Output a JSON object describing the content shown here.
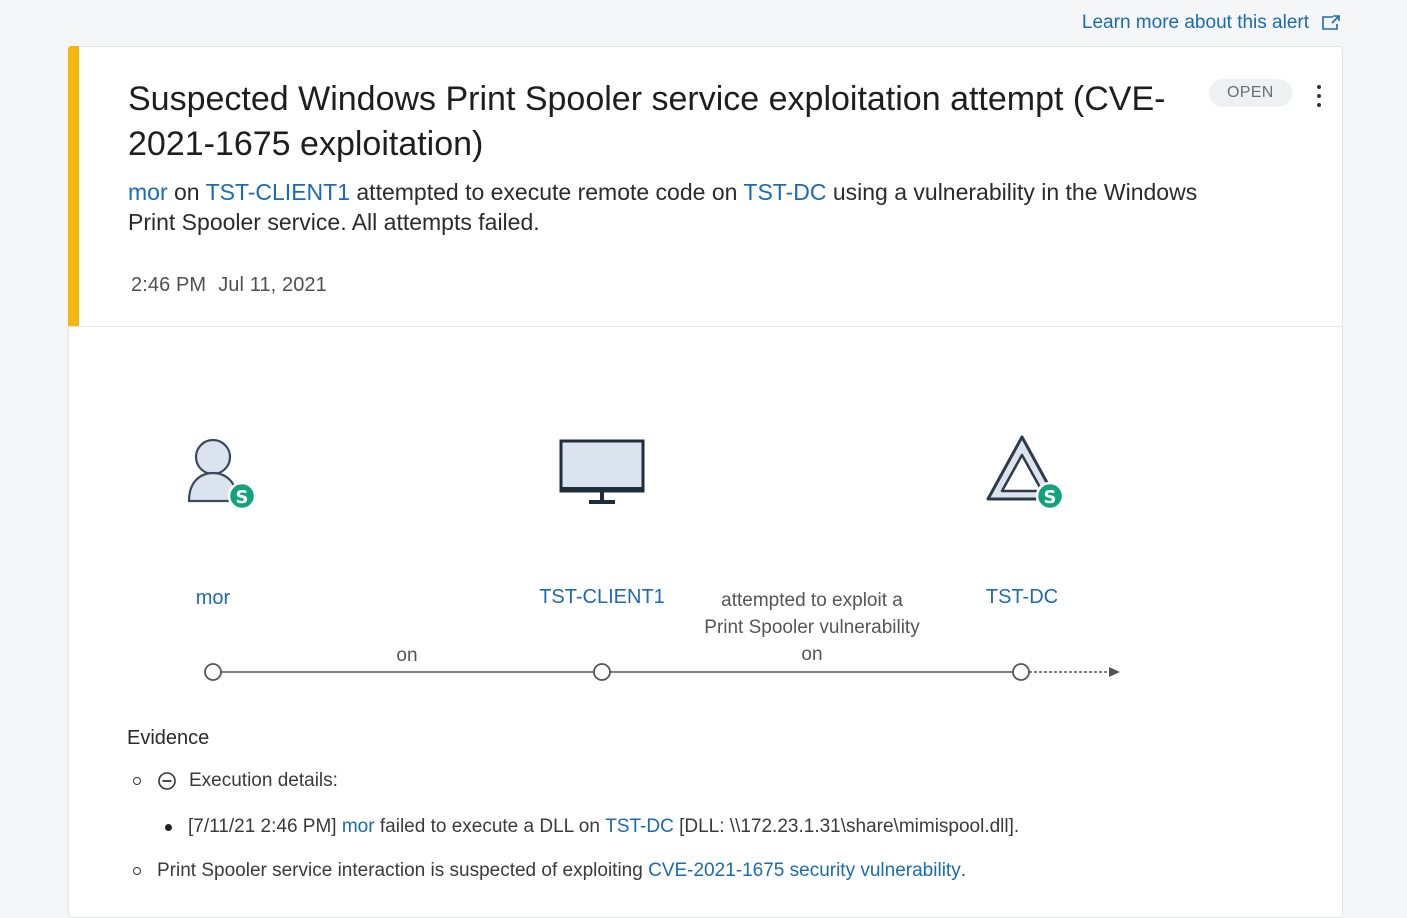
{
  "learn_more": {
    "label": "Learn more about this alert",
    "icon": "external-link-icon"
  },
  "alert": {
    "title": "Suspected Windows Print Spooler service exploitation attempt (CVE-2021-1675 exploitation)",
    "status": "OPEN",
    "accent_color": "#f5b60f",
    "description": {
      "user": "mor",
      "on_word": " on ",
      "source_host": "TST-CLIENT1",
      "middle": " attempted to execute remote code on ",
      "target_host": "TST-DC",
      "tail": " using a vulnerability in the Windows Print Spooler service. All attempts failed."
    },
    "time": "2:46 PM",
    "date": "Jul 11, 2021"
  },
  "diagram": {
    "nodes": [
      {
        "label": "mor",
        "icon": "user-icon",
        "badge": "S"
      },
      {
        "label": "TST-CLIENT1",
        "icon": "monitor-icon"
      },
      {
        "label": "TST-DC",
        "icon": "domain-controller-icon",
        "badge": "S"
      }
    ],
    "edges": [
      {
        "label": "on"
      },
      {
        "label_line1": "attempted to exploit a",
        "label_line2": "Print Spooler vulnerability",
        "label_line3": "on"
      }
    ]
  },
  "evidence": {
    "title": "Evidence",
    "execution_details_label": "Execution details:",
    "detail": {
      "prefix": "[7/11/21 2:46 PM] ",
      "user": "mor",
      "middle": " failed to execute a DLL on ",
      "host": "TST-DC",
      "suffix": " [DLL: \\\\172.23.1.31\\share\\mimispool.dll]."
    },
    "interaction": {
      "prefix": "Print Spooler service interaction is suspected of exploiting ",
      "link": "CVE-2021-1675 security vulnerability",
      "suffix": "."
    }
  }
}
